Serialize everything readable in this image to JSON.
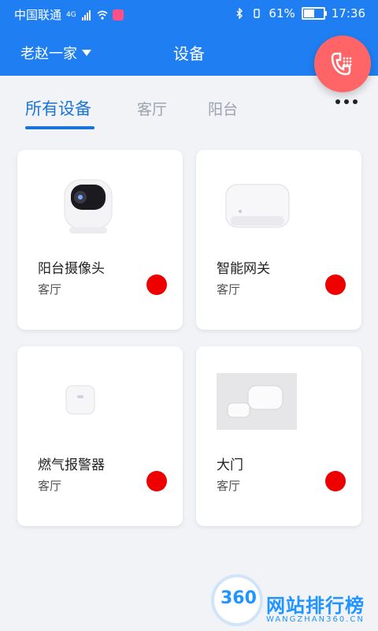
{
  "status": {
    "carrier": "中国联通",
    "network": "4G",
    "battery": "61%",
    "battery_level": 0.61,
    "time": "17:36"
  },
  "header": {
    "family": "老赵一家",
    "title": "设备"
  },
  "tabs": [
    {
      "label": "所有设备",
      "active": true
    },
    {
      "label": "客厅",
      "active": false
    },
    {
      "label": "阳台",
      "active": false
    }
  ],
  "devices": [
    {
      "name": "阳台摄像头",
      "room": "客厅",
      "status_color": "#ee0000"
    },
    {
      "name": "智能网关",
      "room": "客厅",
      "status_color": "#ee0000"
    },
    {
      "name": "燃气报警器",
      "room": "客厅",
      "status_color": "#ee0000"
    },
    {
      "name": "大门",
      "room": "客厅",
      "status_color": "#ee0000"
    }
  ],
  "watermark": {
    "logo_number": "360",
    "text": "网站排行榜",
    "subtext": "WANGZHAN360.CN"
  },
  "colors": {
    "header_bg": "#1f7ff2",
    "accent": "#1a74d9",
    "fab_bg": "#ff6566",
    "status_dot": "#ee0000"
  }
}
